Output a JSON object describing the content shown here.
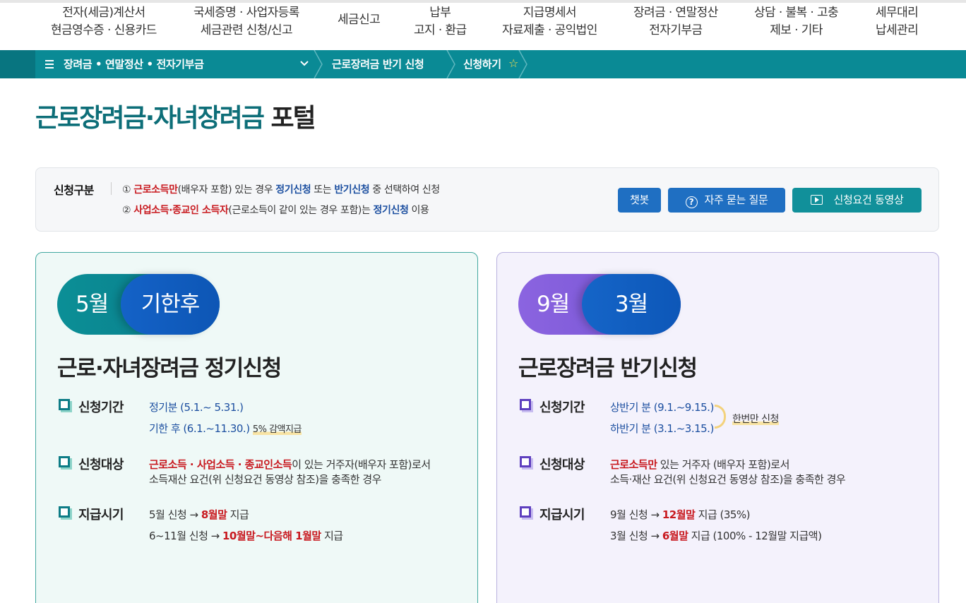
{
  "top_nav": [
    {
      "line1": "전자(세금)계산서",
      "line2": "현금영수증 · 신용카드"
    },
    {
      "line1": "국세증명 · 사업자등록",
      "line2": "세금관련 신청/신고"
    },
    {
      "line1": "세금신고",
      "line2": ""
    },
    {
      "line1": "납부",
      "line2": "고지 · 환급"
    },
    {
      "line1": "지급명세서",
      "line2": "자료제출 · 공익법인"
    },
    {
      "line1": "장려금 · 연말정산",
      "line2": "전자기부금"
    },
    {
      "line1": "상담 · 불복 · 고충",
      "line2": "제보 · 기타"
    },
    {
      "line1": "세무대리",
      "line2": "납세관리"
    }
  ],
  "breadcrumb": {
    "menu": "장려금 • 연말정산 • 전자기부금",
    "item2": "근로장려금 반기 신청",
    "item3": "신청하기"
  },
  "page_title": {
    "accent": "근로장려금·자녀장려금",
    "rest": "포털"
  },
  "info": {
    "label": "신청구분",
    "line1": {
      "prefix": "①",
      "red": "근로소득만",
      "t1": "(배우자 포함) 있는 경우",
      "blue1": "정기신청",
      "t2": "또는",
      "blue2": "반기신청",
      "t3": "중 선택하여 신청"
    },
    "line2": {
      "prefix": "②",
      "red": "사업소득·종교인 소득자",
      "t1": "(근로소득이 같이 있는 경우 포함)는",
      "blue1": "정기신청",
      "t2": "이용"
    },
    "buttons": {
      "chatbot": "챗봇",
      "faq": "자주 묻는 질문",
      "video": "신청요건 동영상"
    }
  },
  "cards": [
    {
      "pill1": "5월",
      "pill2": "기한후",
      "title": "근로·자녀장려금 정기신청",
      "period_label": "신청기간",
      "period1": "정기분 (5.1.~ 5.31.)",
      "period2": "기한 후 (6.1.~11.30.)",
      "period2_note": "5% 감액지급",
      "target_label": "신청대상",
      "target_red": "근로소득 · 사업소득 · 종교인소득",
      "target_t1": "이 있는 거주자(배우자 포함)로서",
      "target_t2": "소득재산 요건(위 신청요건 동영상 참조)을 충족한 경우",
      "pay_label": "지급시기",
      "pay1_a": "5월 신청 →",
      "pay1_red": "8월말",
      "pay1_b": "지급",
      "pay2_a": "6~11월 신청 →",
      "pay2_red": "10월말~다음해 1월말",
      "pay2_b": "지급"
    },
    {
      "pill1": "9월",
      "pill2": "3월",
      "title": "근로장려금 반기신청",
      "period_label": "신청기간",
      "period1": "상반기 분 (9.1.~9.15.)",
      "period2": "하반기 분 (3.1.~3.15.)",
      "period_note": "한번만 신청",
      "target_label": "신청대상",
      "target_red": "근로소득만",
      "target_t1": "있는 거주자 (배우자 포함)로서",
      "target_t2": "소득·재산 요건(위 신청요건 동영상 참조)을 충족한 경우",
      "pay_label": "지급시기",
      "pay1_a": "9월 신청 →",
      "pay1_red": "12월말",
      "pay1_b": "지급 (35%)",
      "pay2_a": "3월 신청 →",
      "pay2_red": "6월말",
      "pay2_b": "지급 (100% - 12월말 지급액)"
    }
  ],
  "colors": {
    "teal": "#0a8a95",
    "title_accent": "#0d6e78",
    "red": "#c8191f",
    "blue": "#1c4fa0",
    "purple": "#7453d2"
  }
}
